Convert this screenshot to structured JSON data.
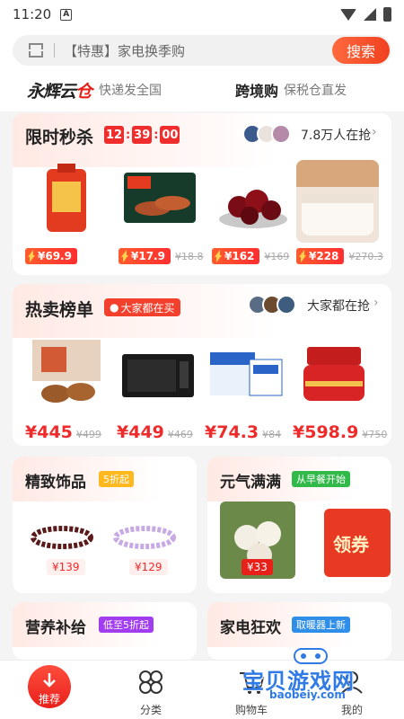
{
  "status": {
    "time": "11:20",
    "notif_letter": "A"
  },
  "search": {
    "placeholder": "【特惠】家电换季购",
    "button": "搜索"
  },
  "brand": {
    "logo": "永辉云",
    "logo_accent": "仓",
    "subtitle": "快递发全国",
    "cross_title": "跨境购",
    "cross_sub": "保税仓直发"
  },
  "flash_sale": {
    "title": "限时秒杀",
    "timer": [
      "12",
      "39",
      "00"
    ],
    "grabbing": "7.8万人在抢",
    "products": [
      {
        "icon": "rice-bag",
        "price": "¥69.9",
        "old_price": ""
      },
      {
        "icon": "sausage-pack",
        "price": "¥17.9",
        "old_price": "¥18.8"
      },
      {
        "icon": "cherries",
        "price": "¥162",
        "old_price": "¥169"
      },
      {
        "icon": "wool-quilt",
        "price": "¥228",
        "old_price": "¥270.3"
      }
    ]
  },
  "hot_list": {
    "title": "热卖榜单",
    "badge": "大家都在买",
    "grabbing": "大家都在抢",
    "products": [
      {
        "icon": "mooncake-box",
        "price": "¥445",
        "old_price": "¥499"
      },
      {
        "icon": "microwave",
        "price": "¥449",
        "old_price": "¥469"
      },
      {
        "icon": "milk-box",
        "price": "¥74.3",
        "old_price": "¥84"
      },
      {
        "icon": "skincare-jar",
        "price": "¥598.9",
        "old_price": "¥750"
      }
    ]
  },
  "jewelry": {
    "title": "精致饰品",
    "badge": "5折起",
    "prices": [
      "¥139",
      "¥129"
    ]
  },
  "vitality": {
    "title": "元气满满",
    "badge": "从早餐开始",
    "price": "¥33",
    "coupon": "领券"
  },
  "nutrition": {
    "title": "营养补给",
    "badge": "低至5折起"
  },
  "appliance": {
    "title": "家电狂欢",
    "badge": "取暖器上新"
  },
  "nav": {
    "recommend": "推荐",
    "category": "分类",
    "cart": "购物车",
    "mine": "我的"
  },
  "watermark": {
    "text": "宝贝游戏网",
    "url": "baobeiy.com"
  },
  "colors": {
    "accent": "#f3402c",
    "price": "#ee2a2a",
    "jewelry_badge": "#ffb81e",
    "vitality_badge": "#31b94a",
    "nutrition_badge": "#a23cf0",
    "appliance_badge": "#2f8fe8"
  }
}
